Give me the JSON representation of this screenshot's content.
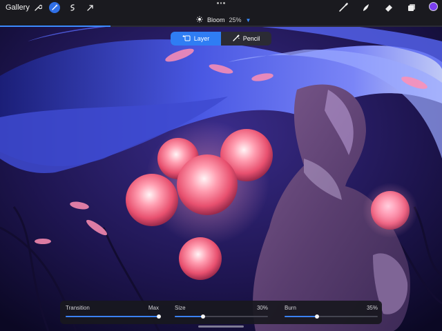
{
  "toolbar": {
    "gallery_label": "Gallery",
    "left_icons": [
      "wrench-icon",
      "magic-wand-icon",
      "selection-icon",
      "transform-arrow-icon"
    ],
    "right_icons": [
      "brush-icon",
      "smudge-icon",
      "eraser-icon",
      "layers-icon"
    ],
    "active_tool": "magic-wand-icon",
    "current_color": "#7b3ff0"
  },
  "adjustment": {
    "name": "Bloom",
    "value": "25%",
    "progress": 0.25
  },
  "mode_toggle": {
    "options": [
      "Layer",
      "Pencil"
    ],
    "selected": "Layer"
  },
  "sliders": [
    {
      "label": "Transition",
      "value": "Max",
      "fraction": 1.0
    },
    {
      "label": "Size",
      "value": "30%",
      "fraction": 0.3
    },
    {
      "label": "Burn",
      "value": "35%",
      "fraction": 0.35
    }
  ],
  "colors": {
    "accent": "#2f7df4",
    "toolbar_bg": "#1a1a1f",
    "panel_bg": "#18181e"
  }
}
